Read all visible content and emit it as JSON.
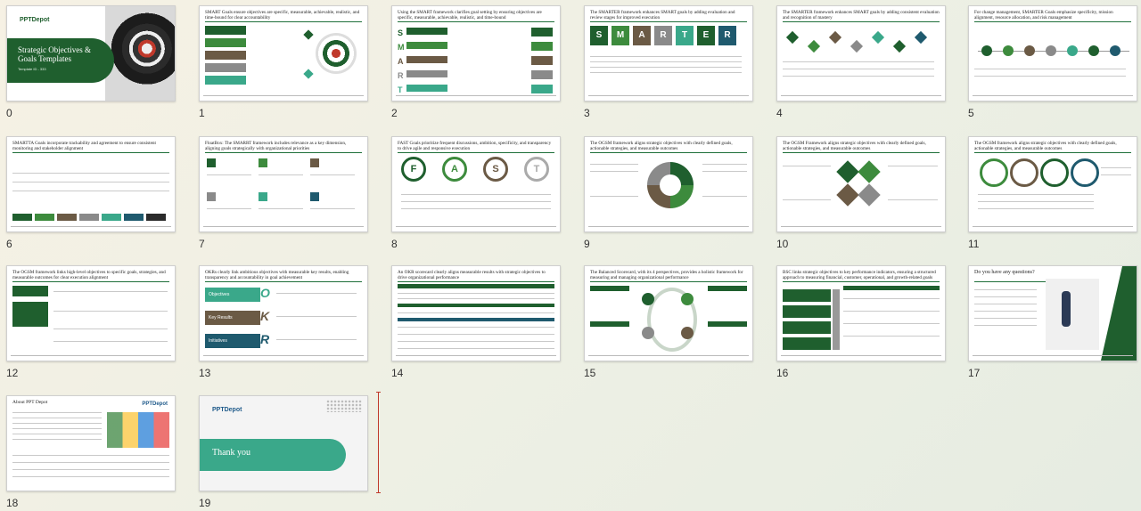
{
  "slides": [
    {
      "num": "0",
      "title": "",
      "cover_brand": "PPTDepot",
      "cover_title": "Strategic Objectives & Goals Templates",
      "cover_sub": "Template ID - 333"
    },
    {
      "num": "1",
      "title": "SMART Goals ensure objectives are specific, measurable, achievable, realistic, and time-bound for clear accountability"
    },
    {
      "num": "2",
      "title": "Using the SMART framework clarifies goal setting by ensuring objectives are specific, measurable, achievable, realistic, and time-bound"
    },
    {
      "num": "3",
      "title": "The SMARTER framework enhances SMART goals by adding evaluation and review stages for improved execution"
    },
    {
      "num": "4",
      "title": "The SMARTER framework enhances SMART goals by adding consistent evaluation and recognition of mastery"
    },
    {
      "num": "5",
      "title": "For change management, SMARTER Goals emphasize specificity, mission alignment, resource allocation, and risk management"
    },
    {
      "num": "6",
      "title": "SMARTTA Goals incorporate trackability and agreement to ensure consistent monitoring and stakeholder alignment"
    },
    {
      "num": "7",
      "title": "FloatBox: The SMARRT framework includes relevance as a key dimension, aligning goals strategically with organizational priorities"
    },
    {
      "num": "8",
      "title": "FAST Goals prioritize frequent discussions, ambition, specificity, and transparency to drive agile and responsive execution"
    },
    {
      "num": "9",
      "title": "The OGSM framework aligns strategic objectives with clearly defined goals, actionable strategies, and measurable outcomes"
    },
    {
      "num": "10",
      "title": "The OGSM Framework aligns strategic objectives with clearly defined goals, actionable strategies, and measurable outcomes"
    },
    {
      "num": "11",
      "title": "The OGSM framework aligns strategic objectives with clearly defined goals, actionable strategies, and measurable outcomes"
    },
    {
      "num": "12",
      "title": "The OGSM framework links high-level objectives to specific goals, strategies, and measurable outcomes for clear execution alignment"
    },
    {
      "num": "13",
      "title": "OKRs clearly link ambitious objectives with measurable key results, enabling transparency and accountability in goal achievement"
    },
    {
      "num": "14",
      "title": "An OKR scorecard clearly aligns measurable results with strategic objectives to drive organizational performance"
    },
    {
      "num": "15",
      "title": "The Balanced Scorecard, with its 4 perspectives, provides a holistic framework for measuring and managing organizational performance"
    },
    {
      "num": "16",
      "title": "BSC links strategic objectives to key performance indicators, ensuring a structured approach to measuring financial, customer, operational, and growth-related goals"
    },
    {
      "num": "17",
      "title": "Do you have any questions?"
    },
    {
      "num": "18",
      "title": "About PPT Depot",
      "brand": "PPTDepot"
    },
    {
      "num": "19",
      "title": "",
      "brand": "PPTDepot",
      "thanks": "Thank you"
    }
  ],
  "letters": {
    "smart": [
      "S",
      "M",
      "A",
      "R",
      "T"
    ],
    "smarter": [
      "S",
      "M",
      "A",
      "R",
      "T",
      "E",
      "R"
    ],
    "fast": [
      "F",
      "A",
      "S",
      "T"
    ],
    "okr": [
      "O",
      "K",
      "R"
    ],
    "okr_labels": [
      "Objectives",
      "Key Results",
      "Initiatives"
    ]
  },
  "colors": {
    "accent": "#1f5f2e",
    "green2": "#3d8b3d",
    "mint": "#3aa88a",
    "brown": "#6b5a45",
    "teal": "#1f5a6e",
    "gray": "#8a8a8a"
  }
}
